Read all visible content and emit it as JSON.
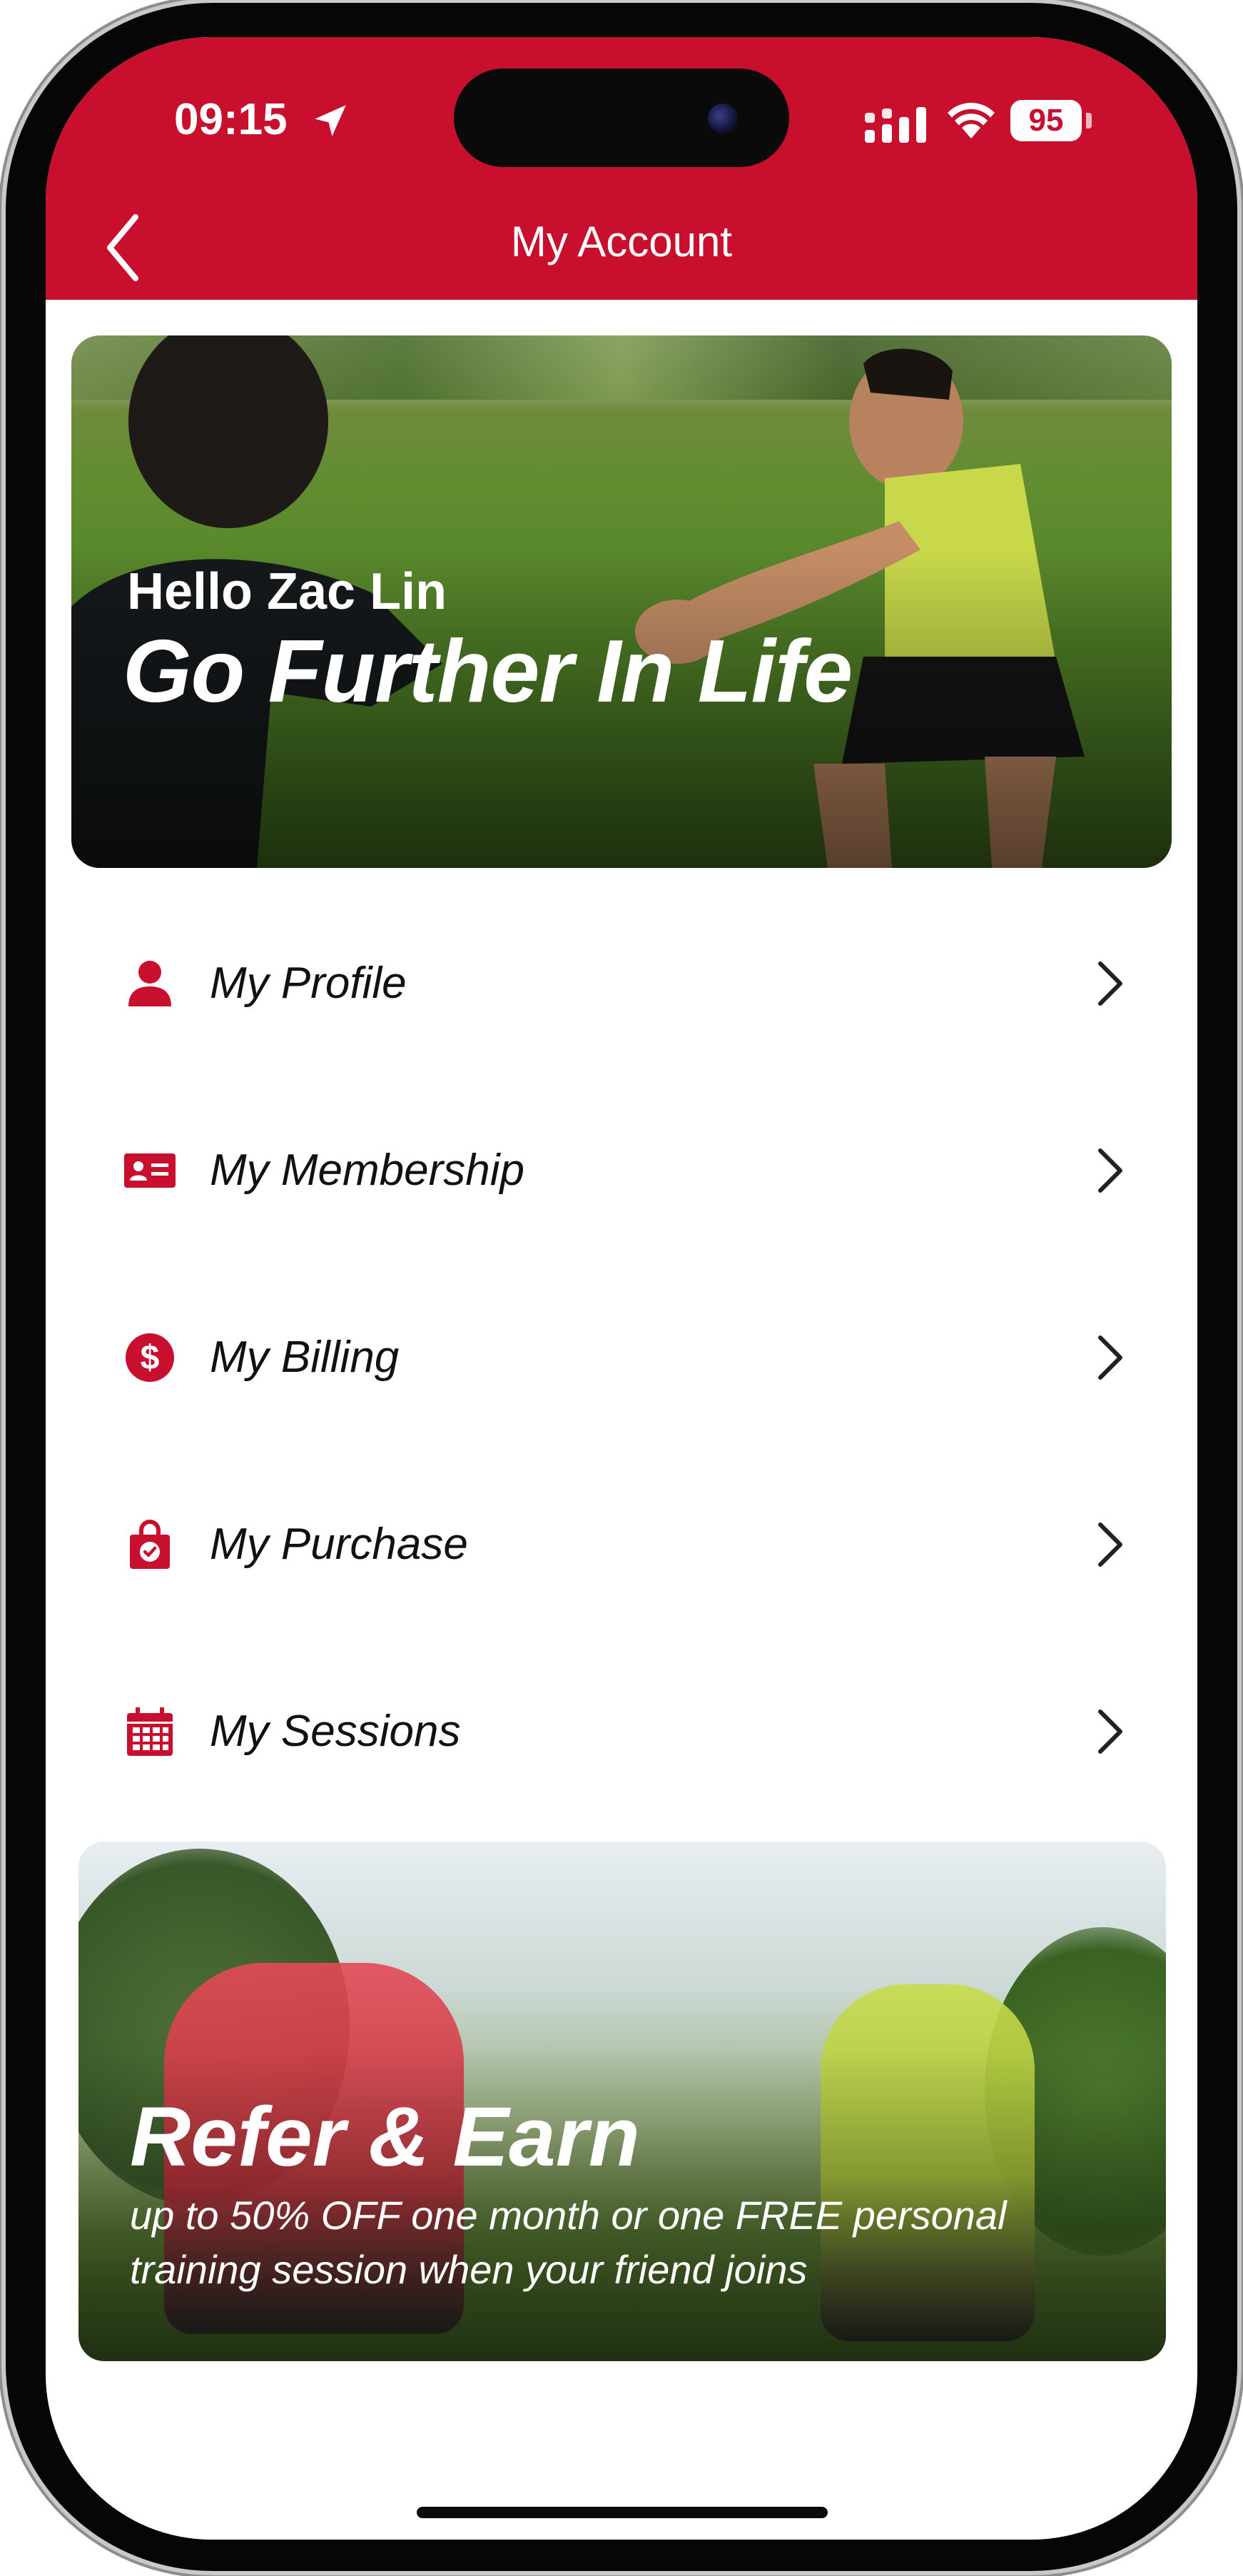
{
  "status_bar": {
    "time": "09:15",
    "battery": "95"
  },
  "nav": {
    "title": "My Account",
    "back_icon": "chevron-left-icon"
  },
  "hero": {
    "greeting": "Hello Zac Lin",
    "tagline": "Go Further In Life"
  },
  "menu": [
    {
      "label": "My Profile",
      "icon": "person-icon"
    },
    {
      "label": "My Membership",
      "icon": "id-card-icon"
    },
    {
      "label": "My Billing",
      "icon": "dollar-circle-icon"
    },
    {
      "label": "My Purchase",
      "icon": "shopping-bag-icon"
    },
    {
      "label": "My Sessions",
      "icon": "calendar-icon"
    }
  ],
  "promo": {
    "title": "Refer & Earn",
    "text": "up to 50% OFF one month or one FREE personal training session when your friend joins"
  },
  "colors": {
    "brand_red": "#c8102e"
  }
}
